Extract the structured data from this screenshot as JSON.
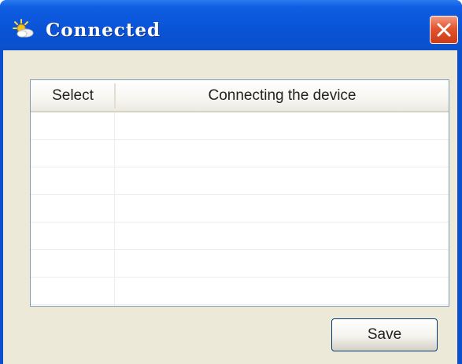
{
  "window": {
    "title": "Connected",
    "icon": "sun-icon",
    "close_icon": "close-icon",
    "colors": {
      "titlebar": "#0a53d6",
      "close": "#e3542f",
      "client": "#ece9d8"
    }
  },
  "table": {
    "columns": [
      "Select",
      "Connecting the device"
    ],
    "rows": [
      [
        "",
        ""
      ],
      [
        "",
        ""
      ],
      [
        "",
        ""
      ],
      [
        "",
        ""
      ],
      [
        "",
        ""
      ],
      [
        "",
        ""
      ],
      [
        "",
        ""
      ]
    ]
  },
  "footer": {
    "save_label": "Save"
  }
}
